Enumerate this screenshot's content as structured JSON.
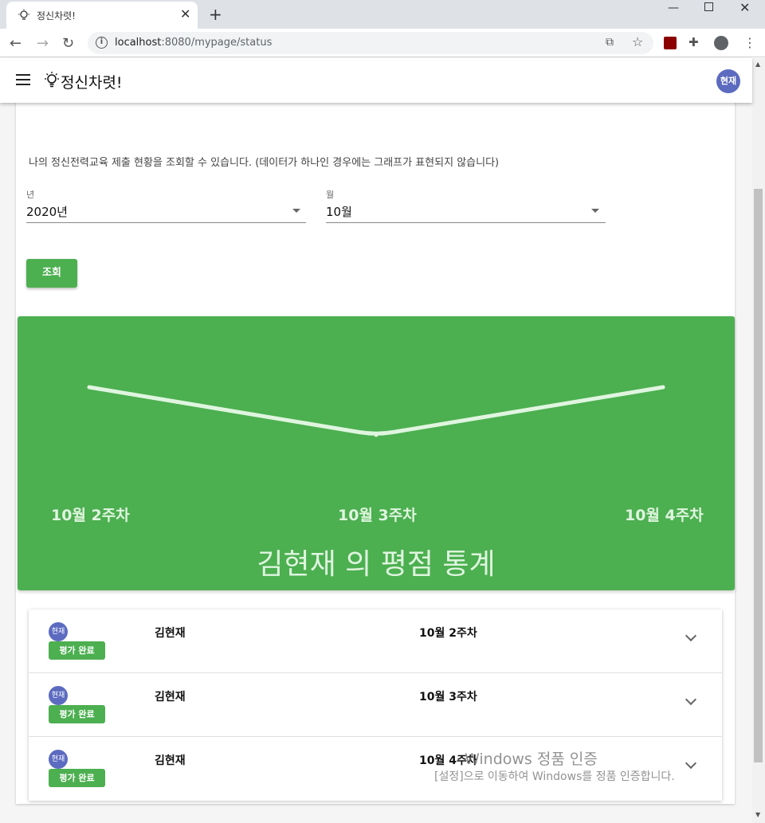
{
  "browser": {
    "tab_title": "정신차렷!",
    "url_host": "localhost",
    "url_rest": ":8080/mypage/status"
  },
  "app": {
    "title": "정신차렷!",
    "user_avatar": "현재"
  },
  "page": {
    "description": "나의 정신전력교육 제출 현황을 조회할 수 있습니다. (데이터가 하나인 경우에는 그래프가 표현되지 않습니다)",
    "year": {
      "label": "년",
      "value": "2020년"
    },
    "month": {
      "label": "월",
      "value": "10월"
    },
    "search_button": "조회"
  },
  "chart_data": {
    "type": "line",
    "title": "김현재 의 평점 통계",
    "categories": [
      "10월 2주차",
      "10월 3주차",
      "10월 4주차"
    ],
    "series": [
      {
        "values": [
          3,
          2,
          3
        ]
      }
    ],
    "color": "#4caf50"
  },
  "records": [
    {
      "avatar": "현재",
      "status": "평가 완료",
      "name": "김현재",
      "week": "10월 2주차"
    },
    {
      "avatar": "현재",
      "status": "평가 완료",
      "name": "김현재",
      "week": "10월 3주차"
    },
    {
      "avatar": "현재",
      "status": "평가 완료",
      "name": "김현재",
      "week": "10월 4주차"
    }
  ],
  "watermark": {
    "line1": "Windows 정품 인증",
    "line2": "[설정]으로 이동하여 Windows를 정품 인증합니다."
  }
}
